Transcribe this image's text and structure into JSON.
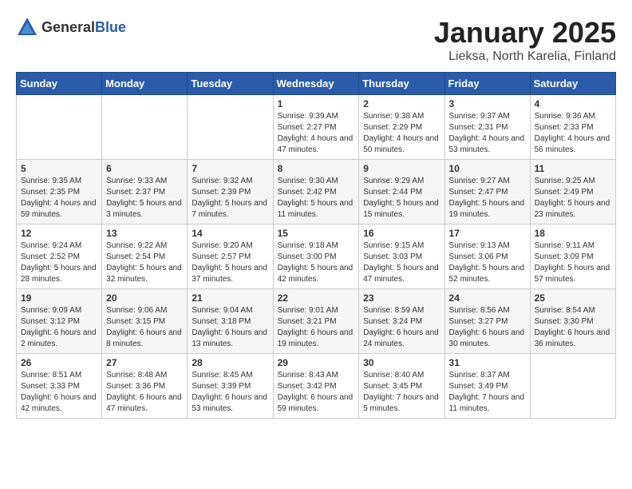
{
  "header": {
    "logo_general": "General",
    "logo_blue": "Blue",
    "month": "January 2025",
    "location": "Lieksa, North Karelia, Finland"
  },
  "weekdays": [
    "Sunday",
    "Monday",
    "Tuesday",
    "Wednesday",
    "Thursday",
    "Friday",
    "Saturday"
  ],
  "weeks": [
    [
      {
        "day": "",
        "info": ""
      },
      {
        "day": "",
        "info": ""
      },
      {
        "day": "",
        "info": ""
      },
      {
        "day": "1",
        "info": "Sunrise: 9:39 AM\nSunset: 2:27 PM\nDaylight: 4 hours and 47 minutes."
      },
      {
        "day": "2",
        "info": "Sunrise: 9:38 AM\nSunset: 2:29 PM\nDaylight: 4 hours and 50 minutes."
      },
      {
        "day": "3",
        "info": "Sunrise: 9:37 AM\nSunset: 2:31 PM\nDaylight: 4 hours and 53 minutes."
      },
      {
        "day": "4",
        "info": "Sunrise: 9:36 AM\nSunset: 2:33 PM\nDaylight: 4 hours and 56 minutes."
      }
    ],
    [
      {
        "day": "5",
        "info": "Sunrise: 9:35 AM\nSunset: 2:35 PM\nDaylight: 4 hours and 59 minutes."
      },
      {
        "day": "6",
        "info": "Sunrise: 9:33 AM\nSunset: 2:37 PM\nDaylight: 5 hours and 3 minutes."
      },
      {
        "day": "7",
        "info": "Sunrise: 9:32 AM\nSunset: 2:39 PM\nDaylight: 5 hours and 7 minutes."
      },
      {
        "day": "8",
        "info": "Sunrise: 9:30 AM\nSunset: 2:42 PM\nDaylight: 5 hours and 11 minutes."
      },
      {
        "day": "9",
        "info": "Sunrise: 9:29 AM\nSunset: 2:44 PM\nDaylight: 5 hours and 15 minutes."
      },
      {
        "day": "10",
        "info": "Sunrise: 9:27 AM\nSunset: 2:47 PM\nDaylight: 5 hours and 19 minutes."
      },
      {
        "day": "11",
        "info": "Sunrise: 9:25 AM\nSunset: 2:49 PM\nDaylight: 5 hours and 23 minutes."
      }
    ],
    [
      {
        "day": "12",
        "info": "Sunrise: 9:24 AM\nSunset: 2:52 PM\nDaylight: 5 hours and 28 minutes."
      },
      {
        "day": "13",
        "info": "Sunrise: 9:22 AM\nSunset: 2:54 PM\nDaylight: 5 hours and 32 minutes."
      },
      {
        "day": "14",
        "info": "Sunrise: 9:20 AM\nSunset: 2:57 PM\nDaylight: 5 hours and 37 minutes."
      },
      {
        "day": "15",
        "info": "Sunrise: 9:18 AM\nSunset: 3:00 PM\nDaylight: 5 hours and 42 minutes."
      },
      {
        "day": "16",
        "info": "Sunrise: 9:15 AM\nSunset: 3:03 PM\nDaylight: 5 hours and 47 minutes."
      },
      {
        "day": "17",
        "info": "Sunrise: 9:13 AM\nSunset: 3:06 PM\nDaylight: 5 hours and 52 minutes."
      },
      {
        "day": "18",
        "info": "Sunrise: 9:11 AM\nSunset: 3:09 PM\nDaylight: 5 hours and 57 minutes."
      }
    ],
    [
      {
        "day": "19",
        "info": "Sunrise: 9:09 AM\nSunset: 3:12 PM\nDaylight: 6 hours and 2 minutes."
      },
      {
        "day": "20",
        "info": "Sunrise: 9:06 AM\nSunset: 3:15 PM\nDaylight: 6 hours and 8 minutes."
      },
      {
        "day": "21",
        "info": "Sunrise: 9:04 AM\nSunset: 3:18 PM\nDaylight: 6 hours and 13 minutes."
      },
      {
        "day": "22",
        "info": "Sunrise: 9:01 AM\nSunset: 3:21 PM\nDaylight: 6 hours and 19 minutes."
      },
      {
        "day": "23",
        "info": "Sunrise: 8:59 AM\nSunset: 3:24 PM\nDaylight: 6 hours and 24 minutes."
      },
      {
        "day": "24",
        "info": "Sunrise: 8:56 AM\nSunset: 3:27 PM\nDaylight: 6 hours and 30 minutes."
      },
      {
        "day": "25",
        "info": "Sunrise: 8:54 AM\nSunset: 3:30 PM\nDaylight: 6 hours and 36 minutes."
      }
    ],
    [
      {
        "day": "26",
        "info": "Sunrise: 8:51 AM\nSunset: 3:33 PM\nDaylight: 6 hours and 42 minutes."
      },
      {
        "day": "27",
        "info": "Sunrise: 8:48 AM\nSunset: 3:36 PM\nDaylight: 6 hours and 47 minutes."
      },
      {
        "day": "28",
        "info": "Sunrise: 8:45 AM\nSunset: 3:39 PM\nDaylight: 6 hours and 53 minutes."
      },
      {
        "day": "29",
        "info": "Sunrise: 8:43 AM\nSunset: 3:42 PM\nDaylight: 6 hours and 59 minutes."
      },
      {
        "day": "30",
        "info": "Sunrise: 8:40 AM\nSunset: 3:45 PM\nDaylight: 7 hours and 5 minutes."
      },
      {
        "day": "31",
        "info": "Sunrise: 8:37 AM\nSunset: 3:49 PM\nDaylight: 7 hours and 11 minutes."
      },
      {
        "day": "",
        "info": ""
      }
    ]
  ]
}
